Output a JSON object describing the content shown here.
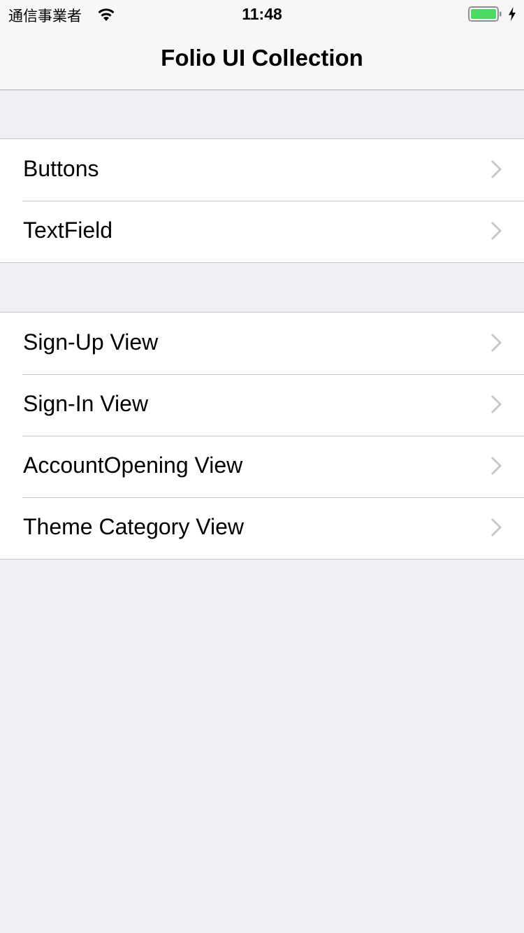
{
  "status_bar": {
    "carrier": "通信事業者",
    "time": "11:48",
    "icons": [
      "wifi-icon",
      "battery-icon",
      "charging-bolt-icon"
    ],
    "battery_color": "#4cd964"
  },
  "nav": {
    "title": "Folio UI Collection"
  },
  "sections": [
    {
      "items": [
        {
          "label": "Buttons",
          "icon": "chevron-right-icon"
        },
        {
          "label": "TextField",
          "icon": "chevron-right-icon"
        }
      ]
    },
    {
      "items": [
        {
          "label": "Sign-Up View",
          "icon": "chevron-right-icon"
        },
        {
          "label": "Sign-In View",
          "icon": "chevron-right-icon"
        },
        {
          "label": "AccountOpening View",
          "icon": "chevron-right-icon"
        },
        {
          "label": "Theme Category View",
          "icon": "chevron-right-icon"
        }
      ]
    }
  ],
  "colors": {
    "background": "#efeff4",
    "separator": "#c8c7cc",
    "chevron": "#c7c7cc"
  }
}
